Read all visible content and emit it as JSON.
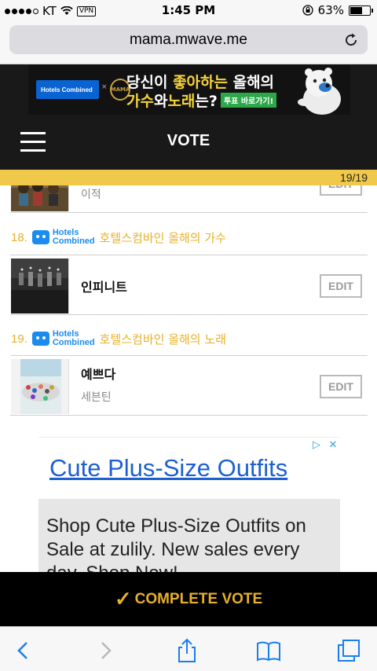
{
  "status_bar": {
    "carrier": "KT",
    "vpn": "VPN",
    "time": "1:45 PM",
    "battery": "63%",
    "battery_level": 0.63
  },
  "browser": {
    "url": "mama.mwave.me"
  },
  "banner": {
    "logo_text": "Hotels Combined",
    "line1_a": "당신이 ",
    "line1_b": "좋아하는",
    "line1_c": " 올해의",
    "line2_a": "가수",
    "line2_b": "와 ",
    "line2_c": "노래",
    "line2_d": "는?",
    "cta": "투표 바로가기!"
  },
  "nav": {
    "title": "VOTE"
  },
  "progress": {
    "text": "19/19",
    "fraction": 1.0
  },
  "list": {
    "prev_item": {
      "subtitle": "이적",
      "edit_label": "EDIT"
    },
    "categories": [
      {
        "number": "18.",
        "sponsor_line1": "Hotels",
        "sponsor_line2": "Combined",
        "label": "호텔스컴바인 올해의 가수",
        "item": {
          "title": "인피니트",
          "subtitle": "",
          "edit_label": "EDIT"
        }
      },
      {
        "number": "19.",
        "sponsor_line1": "Hotels",
        "sponsor_line2": "Combined",
        "label": "호텔스컴바인 올해의 노래",
        "item": {
          "title": "예쁘다",
          "subtitle": "세븐틴",
          "edit_label": "EDIT"
        }
      }
    ]
  },
  "ad": {
    "headline": "Cute Plus-Size Outfits",
    "body": "Shop Cute Plus-Size Outfits on Sale at zulily. New sales every day. Shop Now!"
  },
  "footer": {
    "complete_label": "COMPLETE VOTE"
  }
}
